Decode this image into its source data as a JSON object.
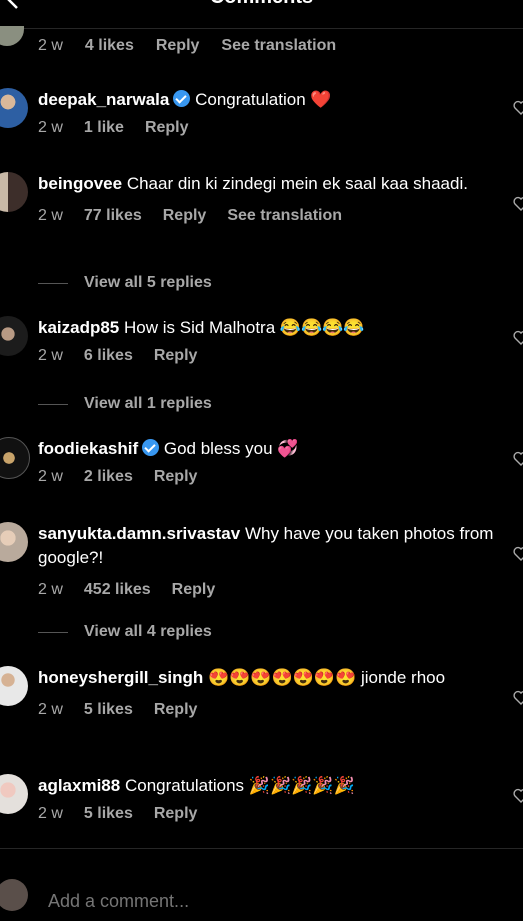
{
  "header": {
    "title": "Comments",
    "back_icon": "chevron-left-icon"
  },
  "top_meta": {
    "time": "2 w",
    "likes": "4 likes",
    "reply": "Reply",
    "translate": "See translation"
  },
  "comments": [
    {
      "user": "deepak_narwala",
      "verified": true,
      "text": "Congratulation",
      "emoji": "❤️",
      "time": "2 w",
      "likes": "1 like",
      "reply": "Reply"
    },
    {
      "user": "beingovee",
      "verified": false,
      "text": "Chaar din ki zindegi mein ek saal kaa shaadi.",
      "time": "2 w",
      "likes": "77 likes",
      "reply": "Reply",
      "translate": "See translation",
      "replies": "View all 5 replies"
    },
    {
      "user": "kaizadp85",
      "verified": false,
      "text": "How is Sid Malhotra",
      "emoji": "😂😂😂😂",
      "time": "2 w",
      "likes": "6 likes",
      "reply": "Reply",
      "replies": "View all 1 replies"
    },
    {
      "user": "foodiekashif",
      "verified": true,
      "text": "God bless you",
      "emoji": "💞",
      "time": "2 w",
      "likes": "2 likes",
      "reply": "Reply"
    },
    {
      "user": "sanyukta.damn.srivastav",
      "verified": false,
      "text": "Why have you taken photos from google?!",
      "time": "2 w",
      "likes": "452 likes",
      "reply": "Reply",
      "replies": "View all 4 replies"
    },
    {
      "user": "honeyshergill_singh",
      "verified": false,
      "text": "jionde rhoo",
      "emoji": "😍😍😍😍😍😍😍",
      "time": "2 w",
      "likes": "5 likes",
      "reply": "Reply"
    },
    {
      "user": "aglaxmi88",
      "verified": false,
      "text": "Congratulations",
      "emoji": "🎉🎉🎉🎉🎉",
      "time": "2 w",
      "likes": "5 likes",
      "reply": "Reply"
    }
  ],
  "composer": {
    "placeholder": "Add a comment..."
  }
}
